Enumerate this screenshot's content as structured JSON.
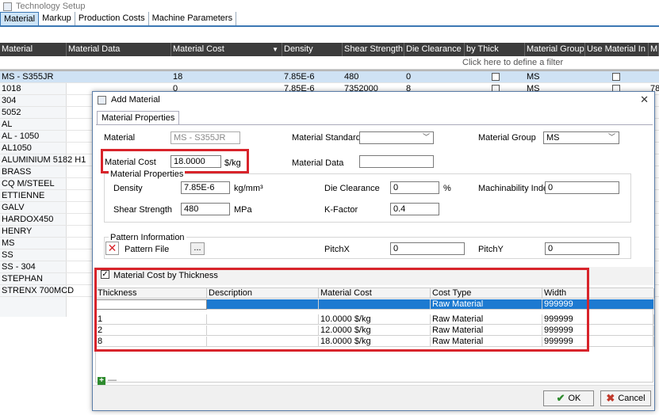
{
  "window": {
    "title": "Technology Setup"
  },
  "tabs": [
    {
      "label": "Material",
      "active": true
    },
    {
      "label": "Markup"
    },
    {
      "label": "Production Costs"
    },
    {
      "label": "Machine Parameters"
    }
  ],
  "grid": {
    "columns": [
      "Material",
      "Material Data",
      "Material Cost",
      "Density",
      "Shear Strength",
      "Die Clearance",
      "by Thick",
      "Material Group",
      "Use Material In CTI",
      "M"
    ],
    "filter_hint": "Click here to define a filter",
    "rows": [
      {
        "material": "MS - S355JR",
        "cost": "18",
        "density": "7.85E-6",
        "shear": "480",
        "clearance": "0",
        "group": "MS"
      },
      {
        "material": "1018",
        "cost": "0",
        "density": "7.85E-6",
        "shear": "7352000",
        "clearance": "8",
        "group": "MS",
        "m": "78"
      },
      {
        "material": "304"
      },
      {
        "material": "5052"
      },
      {
        "material": "AL"
      },
      {
        "material": "AL - 1050"
      },
      {
        "material": "AL1050"
      },
      {
        "material": "ALUMINIUM 5182 H1"
      },
      {
        "material": "BRASS"
      },
      {
        "material": "CQ M/STEEL"
      },
      {
        "material": "ETTIENNE"
      },
      {
        "material": "GALV"
      },
      {
        "material": "HARDOX450"
      },
      {
        "material": "HENRY"
      },
      {
        "material": "MS"
      },
      {
        "material": "SS"
      },
      {
        "material": "SS - 304"
      },
      {
        "material": "STEPHAN"
      },
      {
        "material": "STRENX 700MCD"
      }
    ]
  },
  "dialog": {
    "title": "Add Material",
    "tab": "Material Properties",
    "material_label": "Material",
    "material_value": "MS - S355JR",
    "standard_label": "Material Standard",
    "group_label": "Material Group",
    "group_value": "MS",
    "cost_label": "Material Cost",
    "cost_value": "18.0000",
    "cost_unit": "$/kg",
    "data_label": "Material Data",
    "props_group": "Material Properties",
    "density_label": "Density",
    "density_value": "7.85E-6",
    "density_unit": "kg/mm³",
    "clearance_label": "Die Clearance",
    "clearance_value": "0",
    "clearance_unit": "%",
    "machinability_label": "Machinability Index",
    "machinability_value": "0",
    "shear_label": "Shear Strength",
    "shear_value": "480",
    "shear_unit": "MPa",
    "kfactor_label": "K-Factor",
    "kfactor_value": "0.4",
    "pattern_group": "Pattern Information",
    "pattern_file_label": "Pattern File",
    "browse_label": "...",
    "pitchx_label": "PitchX",
    "pitchx_value": "0",
    "pitchy_label": "PitchY",
    "pitchy_value": "0",
    "by_thickness_label": "Material Cost by Thickness",
    "thickness_columns": [
      "Thickness",
      "Description",
      "Material Cost",
      "Cost Type",
      "Width"
    ],
    "thickness_rows": [
      {
        "thickness": "",
        "description": "",
        "cost": "",
        "type": "Raw Material",
        "width": "999999"
      },
      {
        "thickness": "1",
        "description": "",
        "cost": "10.0000 $/kg",
        "type": "Raw Material",
        "width": "999999"
      },
      {
        "thickness": "2",
        "description": "",
        "cost": "12.0000 $/kg",
        "type": "Raw Material",
        "width": "999999"
      },
      {
        "thickness": "8",
        "description": "",
        "cost": "18.0000 $/kg",
        "type": "Raw Material",
        "width": "999999"
      }
    ],
    "ok_label": "OK",
    "cancel_label": "Cancel"
  }
}
